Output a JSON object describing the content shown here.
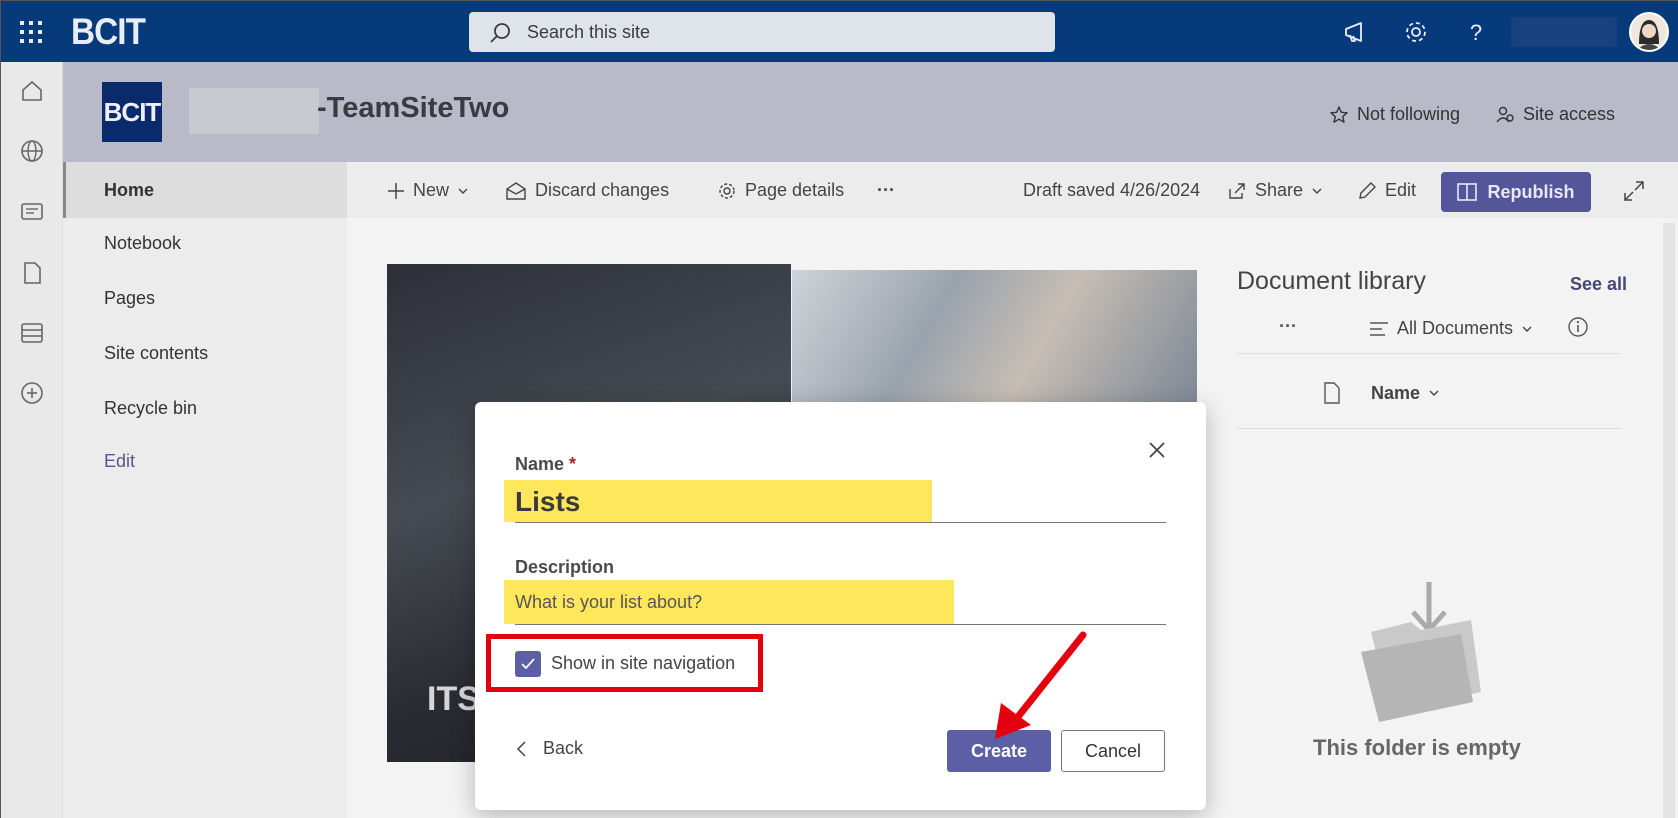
{
  "suite_bar": {
    "brand": "BCIT",
    "search_placeholder": "Search this site"
  },
  "site_header": {
    "logo_text": "BCIT",
    "title": "-TeamSiteTwo",
    "not_following": "Not following",
    "site_access": "Site access"
  },
  "left_nav": {
    "items": [
      {
        "label": "Home",
        "selected": true
      },
      {
        "label": "Notebook"
      },
      {
        "label": "Pages"
      },
      {
        "label": "Site contents"
      },
      {
        "label": "Recycle bin"
      }
    ],
    "edit_label": "Edit"
  },
  "command_bar": {
    "new": "New",
    "discard": "Discard changes",
    "page_details": "Page details",
    "draft_status": "Draft saved 4/26/2024",
    "share": "Share",
    "edit": "Edit",
    "republish": "Republish"
  },
  "hero": {
    "overlay_text": "ITS"
  },
  "document_library": {
    "title": "Document library",
    "see_all": "See all",
    "view": "All Documents",
    "column_name": "Name",
    "empty_message": "This folder is empty"
  },
  "modal": {
    "name_label": "Name",
    "required_marker": "*",
    "name_value": "Lists",
    "description_label": "Description",
    "description_placeholder": "What is your list about?",
    "show_in_nav_label": "Show in site navigation",
    "show_in_nav_checked": true,
    "back_label": "Back",
    "create_label": "Create",
    "cancel_label": "Cancel"
  },
  "colors": {
    "suite_bar": "#063a7a",
    "accent": "#5c5ea6",
    "highlight": "#ffe75c",
    "annotation_red": "#e4000f"
  }
}
